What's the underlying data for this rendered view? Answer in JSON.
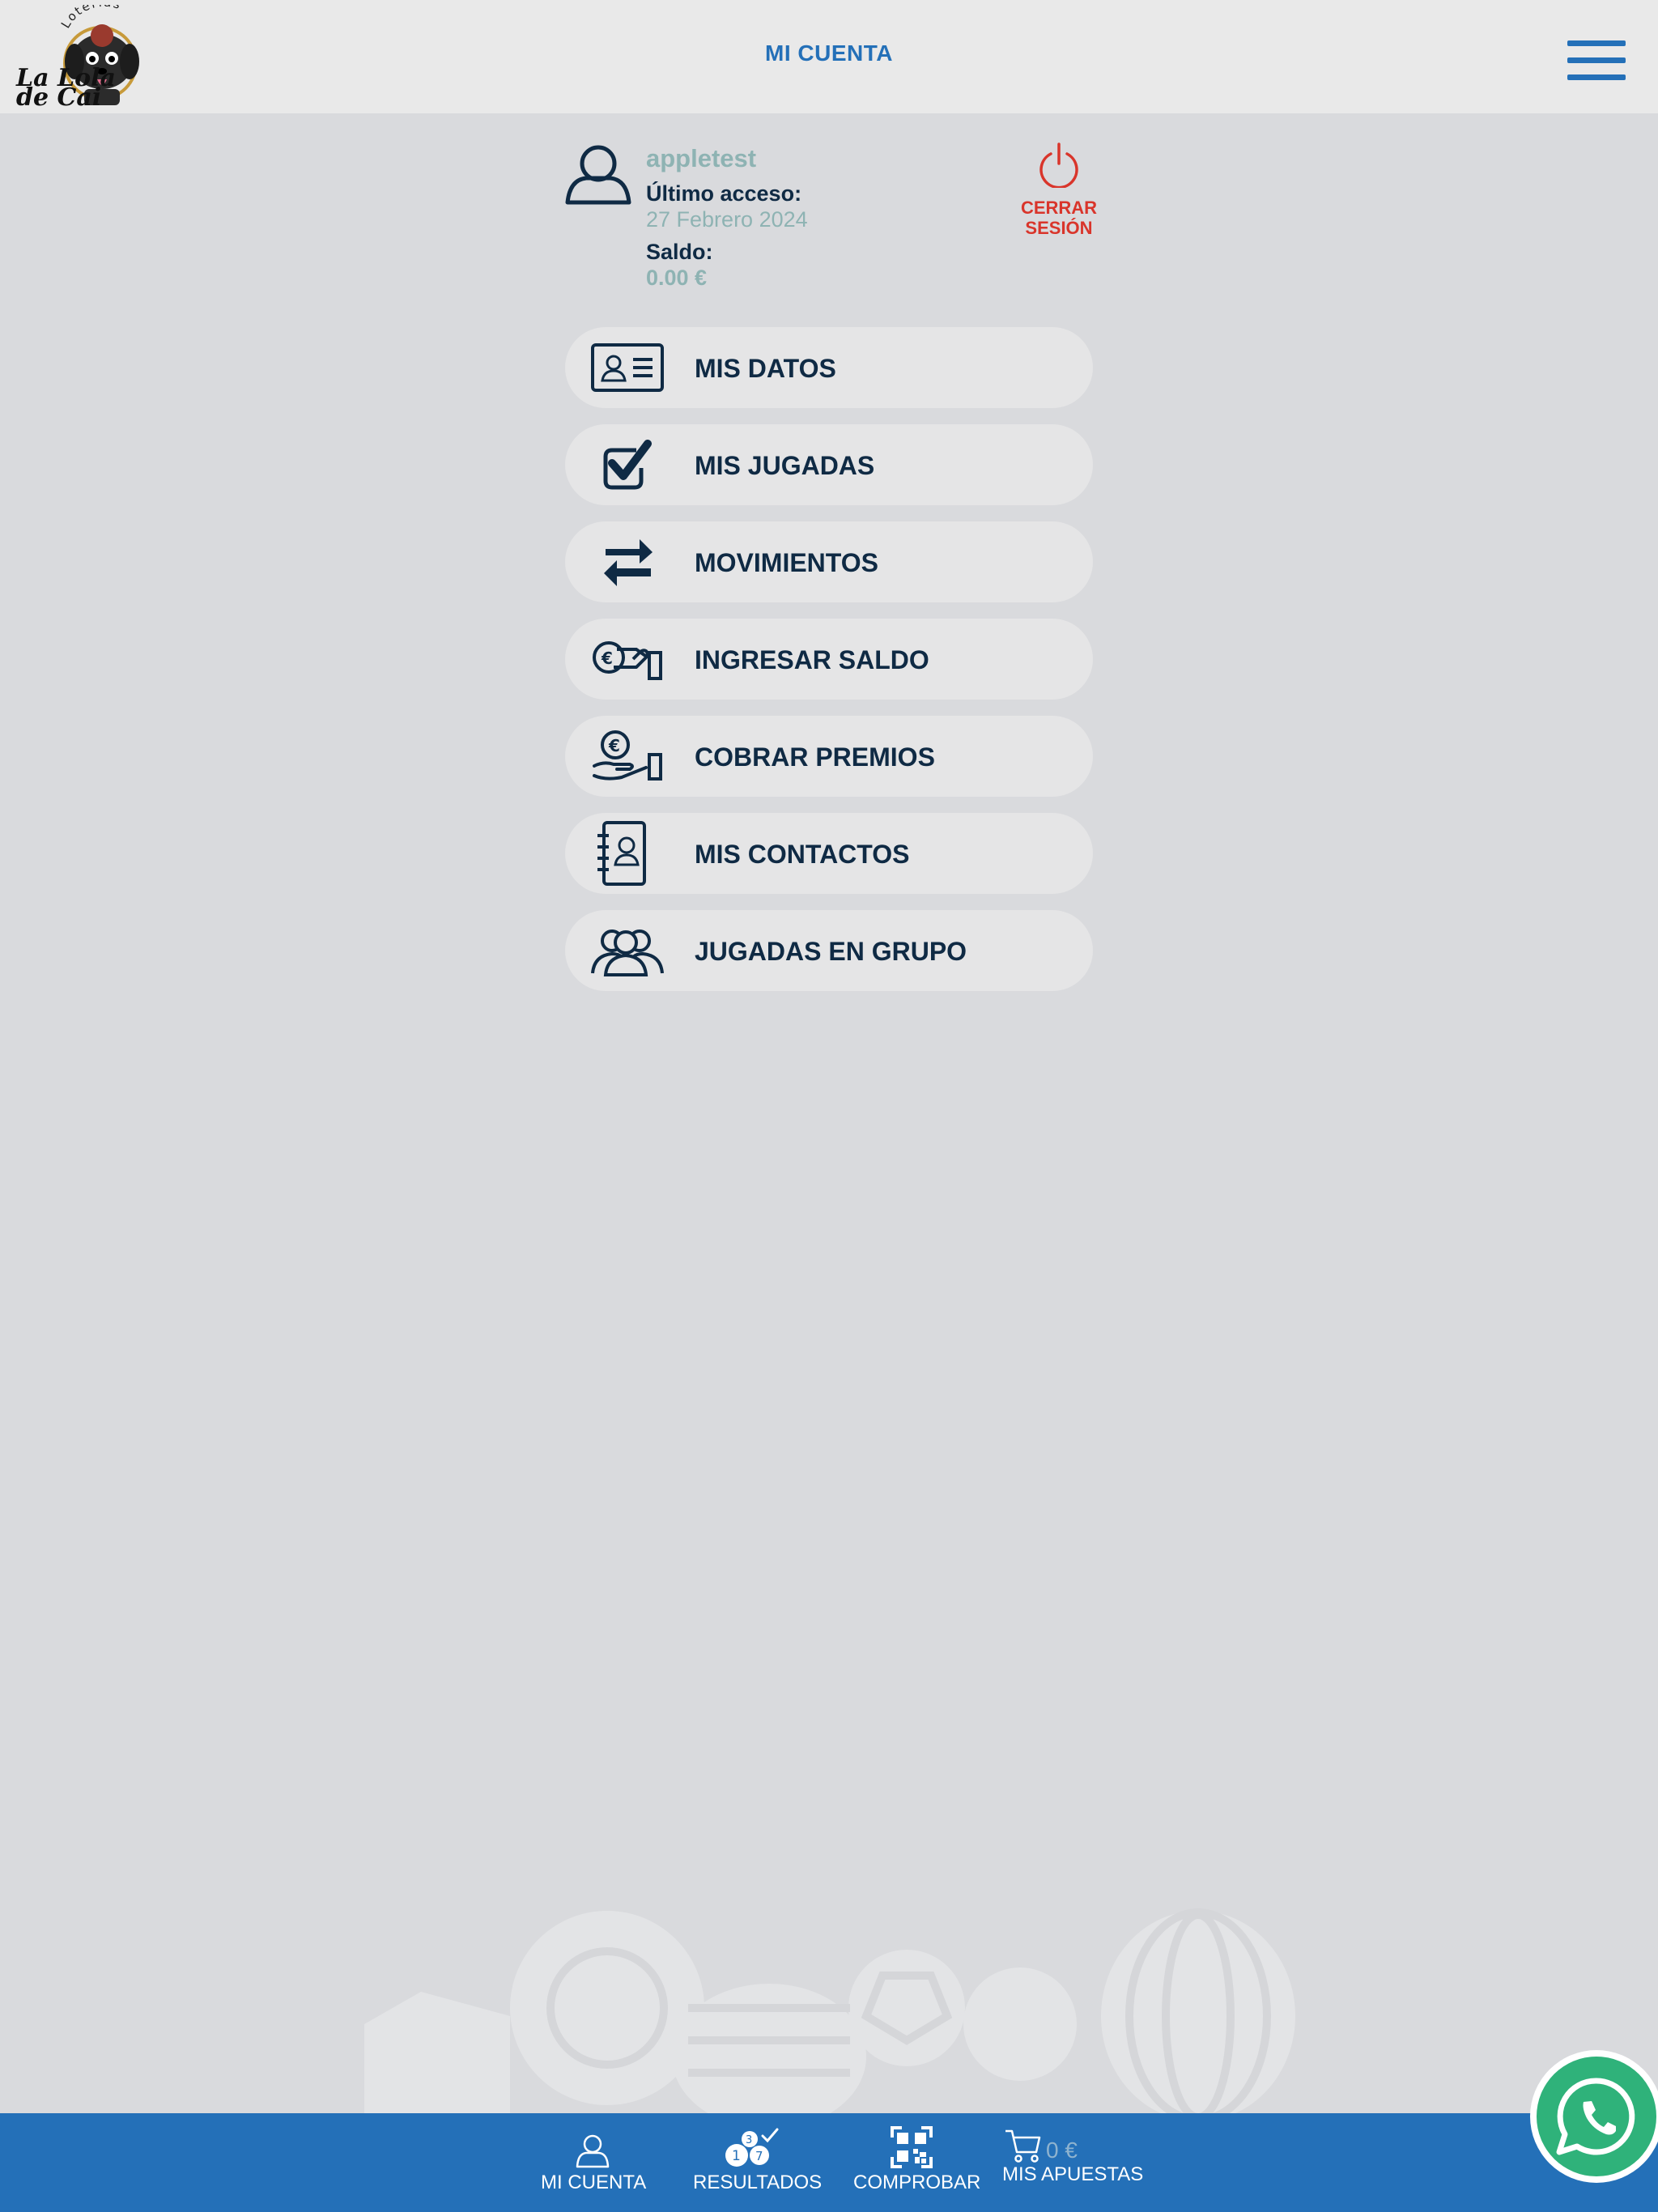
{
  "header": {
    "title": "MI CUENTA",
    "logo": {
      "top_text": "Loterías",
      "line1": "La Lola",
      "line2": "de Cai"
    },
    "menu_icon": "hamburger-icon"
  },
  "profile": {
    "username": "appletest",
    "last_access_label": "Último acceso:",
    "last_access_value": "27 Febrero 2024",
    "balance_label": "Saldo:",
    "balance_value": "0.00 €",
    "logout_label": "CERRAR SESIÓN"
  },
  "menu": {
    "items": [
      {
        "label": "MIS DATOS",
        "icon": "id-card-icon"
      },
      {
        "label": "MIS JUGADAS",
        "icon": "checkbox-icon"
      },
      {
        "label": "MOVIMIENTOS",
        "icon": "transfer-arrows-icon"
      },
      {
        "label": "INGRESAR SALDO",
        "icon": "deposit-coin-icon"
      },
      {
        "label": "COBRAR PREMIOS",
        "icon": "coin-hand-icon"
      },
      {
        "label": "MIS CONTACTOS",
        "icon": "address-book-icon"
      },
      {
        "label": "JUGADAS EN GRUPO",
        "icon": "group-icon"
      }
    ]
  },
  "bottom_nav": {
    "items": [
      {
        "label": "MI CUENTA",
        "icon": "user-icon"
      },
      {
        "label": "RESULTADOS",
        "icon": "lottery-balls-icon",
        "ball_numbers": [
          "1",
          "3",
          "7"
        ]
      },
      {
        "label": "COMPROBAR",
        "icon": "qr-code-icon"
      },
      {
        "label": "MIS APUESTAS",
        "icon": "cart-icon",
        "amount": "0 €"
      }
    ]
  },
  "colors": {
    "brand_blue": "#2470b8",
    "dark_navy": "#0f2a44",
    "muted_teal": "#8eb3b3",
    "logout_red": "#d9352b",
    "whatsapp_green": "#2fb27a",
    "page_bg": "#d9dadd",
    "header_bg": "#e9e9e9"
  }
}
